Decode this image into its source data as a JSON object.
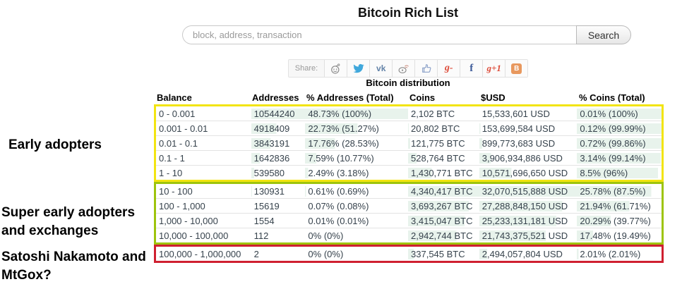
{
  "page": {
    "title": "Bitcoin Rich List"
  },
  "search": {
    "placeholder": "block, address, transaction",
    "button_label": "Search"
  },
  "share": {
    "label": "Share:",
    "icons": [
      {
        "name": "reddit"
      },
      {
        "name": "twitter"
      },
      {
        "name": "vk",
        "text": "vk"
      },
      {
        "name": "weibo"
      },
      {
        "name": "like"
      },
      {
        "name": "google",
        "text": "g-"
      },
      {
        "name": "facebook",
        "text": "f"
      },
      {
        "name": "google-plus-one",
        "text": "g+1"
      },
      {
        "name": "blogger",
        "text": "B"
      }
    ]
  },
  "distribution": {
    "title": "Bitcoin distribution",
    "columns": [
      "Balance",
      "Addresses",
      "% Addresses (Total)",
      "Coins",
      "$USD",
      "% Coins (Total)"
    ],
    "groups": [
      {
        "id": "early-adopters",
        "box_color": "#f2e411",
        "rows": [
          [
            {
              "t": "0 - 0.001",
              "f": 0
            },
            {
              "t": "10544240",
              "f": 100
            },
            {
              "t": "48.73% (100%)",
              "f": 100
            },
            {
              "t": "2,102 BTC",
              "f": 0
            },
            {
              "t": "15,533,601 USD",
              "f": 0
            },
            {
              "t": "0.01% (100%)",
              "f": 100
            }
          ],
          [
            {
              "t": "0.001 - 0.01",
              "f": 0
            },
            {
              "t": "4918409",
              "f": 47
            },
            {
              "t": "22.73% (51.27%)",
              "f": 51
            },
            {
              "t": "20,802 BTC",
              "f": 1
            },
            {
              "t": "153,699,584 USD",
              "f": 1
            },
            {
              "t": "0.12% (99.99%)",
              "f": 100
            }
          ],
          [
            {
              "t": "0.01 - 0.1",
              "f": 0
            },
            {
              "t": "3843191",
              "f": 36
            },
            {
              "t": "17.76% (28.53%)",
              "f": 29
            },
            {
              "t": "121,775 BTC",
              "f": 3
            },
            {
              "t": "899,773,683 USD",
              "f": 3
            },
            {
              "t": "0.72% (99.86%)",
              "f": 100
            }
          ],
          [
            {
              "t": "0.1 - 1",
              "f": 0
            },
            {
              "t": "1642836",
              "f": 16
            },
            {
              "t": "7.59% (10.77%)",
              "f": 11
            },
            {
              "t": "528,764 BTC",
              "f": 12
            },
            {
              "t": "3,906,934,886 USD",
              "f": 12
            },
            {
              "t": "3.14% (99.14%)",
              "f": 99
            }
          ],
          [
            {
              "t": "1 - 10",
              "f": 0
            },
            {
              "t": "539580",
              "f": 5
            },
            {
              "t": "2.49% (3.18%)",
              "f": 3
            },
            {
              "t": "1,430,771 BTC",
              "f": 33
            },
            {
              "t": "10,571,696,650 USD",
              "f": 33
            },
            {
              "t": "8.5% (96%)",
              "f": 96
            }
          ]
        ]
      },
      {
        "id": "super-early-adopters",
        "box_color": "#9ec40c",
        "rows": [
          [
            {
              "t": "10 - 100",
              "f": 0
            },
            {
              "t": "130931",
              "f": 1
            },
            {
              "t": "0.61% (0.69%)",
              "f": 1
            },
            {
              "t": "4,340,417 BTC",
              "f": 100
            },
            {
              "t": "32,070,515,888 USD",
              "f": 100
            },
            {
              "t": "25.78% (87.5%)",
              "f": 88
            }
          ],
          [
            {
              "t": "100 - 1,000",
              "f": 0
            },
            {
              "t": "15619",
              "f": 0
            },
            {
              "t": "0.07% (0.08%)",
              "f": 0
            },
            {
              "t": "3,693,267 BTC",
              "f": 85
            },
            {
              "t": "27,288,848,150 USD",
              "f": 85
            },
            {
              "t": "21.94% (61.71%)",
              "f": 62
            }
          ],
          [
            {
              "t": "1,000 - 10,000",
              "f": 0
            },
            {
              "t": "1554",
              "f": 0
            },
            {
              "t": "0.01% (0.01%)",
              "f": 0
            },
            {
              "t": "3,415,047 BTC",
              "f": 79
            },
            {
              "t": "25,233,131,181 USD",
              "f": 79
            },
            {
              "t": "20.29% (39.77%)",
              "f": 40
            }
          ],
          [
            {
              "t": "10,000 - 100,000",
              "f": 0
            },
            {
              "t": "112",
              "f": 0
            },
            {
              "t": "0% (0%)",
              "f": 0
            },
            {
              "t": "2,942,744 BTC",
              "f": 68
            },
            {
              "t": "21,743,375,521 USD",
              "f": 68
            },
            {
              "t": "17.48% (19.49%)",
              "f": 19
            }
          ]
        ]
      },
      {
        "id": "satoshi-mtgox",
        "box_color": "#cf2030",
        "rows": [
          [
            {
              "t": "100,000 - 1,000,000",
              "f": 0
            },
            {
              "t": "2",
              "f": 0
            },
            {
              "t": "0% (0%)",
              "f": 0
            },
            {
              "t": "337,545 BTC",
              "f": 8
            },
            {
              "t": "2,494,057,804 USD",
              "f": 8
            },
            {
              "t": "2.01% (2.01%)",
              "f": 2
            }
          ]
        ]
      }
    ]
  },
  "annotations": [
    {
      "text": "Early adopters"
    },
    {
      "text": "Super early adopters\nand exchanges"
    },
    {
      "text": "Satoshi Nakamoto and\nMtGox?"
    }
  ],
  "colors": {
    "bar_fill": "#e8f3ec",
    "yellow_box": "#f2e411",
    "green_box": "#9ec40c",
    "red_box": "#cf2030"
  }
}
